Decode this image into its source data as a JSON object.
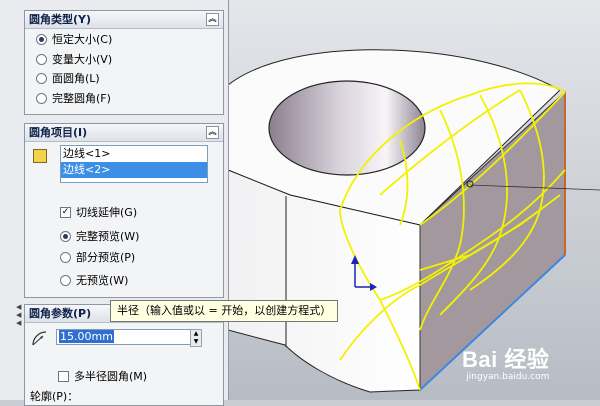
{
  "sections": {
    "fillet_type": {
      "title": "圆角类型(Y)",
      "options": [
        "恒定大小(C)",
        "变量大小(V)",
        "面圆角(L)",
        "完整圆角(F)"
      ],
      "selected_index": 0
    },
    "fillet_items": {
      "title": "圆角项目(I)",
      "edges": [
        "边线<1>",
        "边线<2>"
      ],
      "selected_edge_index": 1,
      "tangent_propagation": {
        "label": "切线延伸(G)",
        "checked": true
      },
      "preview_options": [
        "完整预览(W)",
        "部分预览(P)",
        "无预览(W)"
      ],
      "preview_selected_index": 0
    },
    "fillet_params": {
      "title": "圆角参数(P)",
      "radius_value": "15.00mm",
      "multi_radius": {
        "label": "多半径圆角(M)",
        "checked": false
      },
      "profile_label": "轮廓(P)："
    }
  },
  "tooltip": "半径（输入值或以 = 开始，以创建方程式）",
  "watermark": {
    "main": "Bai 经验",
    "sub": "jingyan.baidu.com"
  },
  "colors": {
    "accent": "#3d8ee6",
    "fillet_preview": "#f2f200",
    "face": "#a3989e"
  }
}
